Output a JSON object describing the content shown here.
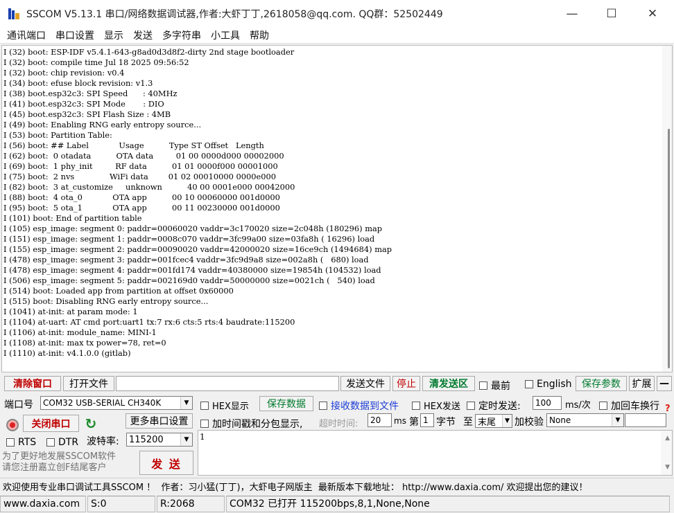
{
  "window": {
    "title": "SSCOM V5.13.1 串口/网络数据调试器,作者:大虾丁丁,2618058@qq.com. QQ群：52502449",
    "min_glyph": "—",
    "max_glyph": "☐",
    "close_glyph": "✕"
  },
  "menu": [
    "通讯端口",
    "串口设置",
    "显示",
    "发送",
    "多字符串",
    "小工具",
    "帮助"
  ],
  "log": [
    "I (32) boot: ESP-IDF v5.4.1-643-g8ad0d3d8f2-dirty 2nd stage bootloader",
    "I (32) boot: compile time Jul 18 2025 09:56:52",
    "I (32) boot: chip revision: v0.4",
    "I (34) boot: efuse block revision: v1.3",
    "I (38) boot.esp32c3: SPI Speed      : 40MHz",
    "I (41) boot.esp32c3: SPI Mode       : DIO",
    "I (45) boot.esp32c3: SPI Flash Size : 4MB",
    "I (49) boot: Enabling RNG early entropy source...",
    "I (53) boot: Partition Table:",
    "I (56) boot: ## Label            Usage          Type ST Offset   Length",
    "I (62) boot:  0 otadata          OTA data         01 00 0000d000 00002000",
    "I (69) boot:  1 phy_init         RF data          01 01 0000f000 00001000",
    "I (75) boot:  2 nvs              WiFi data        01 02 00010000 0000e000",
    "I (82) boot:  3 at_customize     unknown          40 00 0001e000 00042000",
    "I (88) boot:  4 ota_0            OTA app          00 10 00060000 001d0000",
    "I (95) boot:  5 ota_1            OTA app          00 11 00230000 001d0000",
    "I (101) boot: End of partition table",
    "I (105) esp_image: segment 0: paddr=00060020 vaddr=3c170020 size=2c048h (180296) map",
    "I (151) esp_image: segment 1: paddr=0008c070 vaddr=3fc99a00 size=03fa8h ( 16296) load",
    "I (155) esp_image: segment 2: paddr=00090020 vaddr=42000020 size=16ce9ch (1494684) map",
    "I (478) esp_image: segment 3: paddr=001fcec4 vaddr=3fc9d9a8 size=002a8h (   680) load",
    "I (478) esp_image: segment 4: paddr=001fd174 vaddr=40380000 size=19854h (104532) load",
    "I (506) esp_image: segment 5: paddr=002169d0 vaddr=50000000 size=0021ch (   540) load",
    "I (514) boot: Loaded app from partition at offset 0x60000",
    "I (515) boot: Disabling RNG early entropy source...",
    "I (1041) at-init: at param mode: 1",
    "I (1104) at-uart: AT cmd port:uart1 tx:7 rx:6 cts:5 rts:4 baudrate:115200",
    "I (1106) at-init: module_name: MINI-1",
    "I (1108) at-init: max tx power=78, ret=0",
    "I (1110) at-init: v4.1.0.0 (gitlab)"
  ],
  "toolbar": {
    "clear_window": "清除窗口",
    "open_file": "打开文件",
    "send_file": "发送文件",
    "stop": "停止",
    "clear_send_area": "清发送区",
    "topmost": "最前",
    "english": "English",
    "save_params": "保存参数",
    "expand": "扩展",
    "collapse": "—"
  },
  "port": {
    "port_label": "端口号",
    "port_value": "COM32 USB-SERIAL CH340K",
    "close_port": "关闭串口",
    "more_settings": "更多串口设置",
    "rts": "RTS",
    "dtr": "DTR",
    "baud_label": "波特率:",
    "baud_value": "115200"
  },
  "options": {
    "hex_display": "HEX显示",
    "save_data": "保存数据",
    "recv_to_file": "接收数据到文件",
    "hex_send": "HEX发送",
    "timed_send": "定时发送:",
    "interval": "100",
    "interval_unit": "ms/次",
    "add_crlf": "加回车换行",
    "timestamp": "加时间戳和分包显示,",
    "timeout_label": "超时时间:",
    "timeout_value": "20",
    "timeout_unit": "ms",
    "byte_label_1": "第",
    "byte_value": "1",
    "byte_label_2": "字节",
    "to_label": "至",
    "to_value": "末尾",
    "checksum_label": "加校验",
    "checksum_value": "None",
    "help_glyph": "?"
  },
  "send": {
    "text": "1",
    "button": "发 送",
    "promo_line1": "为了更好地发展SSCOM软件",
    "promo_line2": "请您注册嘉立创F结尾客户"
  },
  "marquee": "欢迎使用专业串口调试工具SSCOM ！  作者：习小猛(丁丁)，大虾电子网版主  最新版本下载地址： http://www.daxia.com/ 欢迎提出您的建议！",
  "status": {
    "site": "www.daxia.com",
    "sent": "S:0",
    "received": "R:2068",
    "port_state": "COM32 已打开  115200bps,8,1,None,None"
  }
}
